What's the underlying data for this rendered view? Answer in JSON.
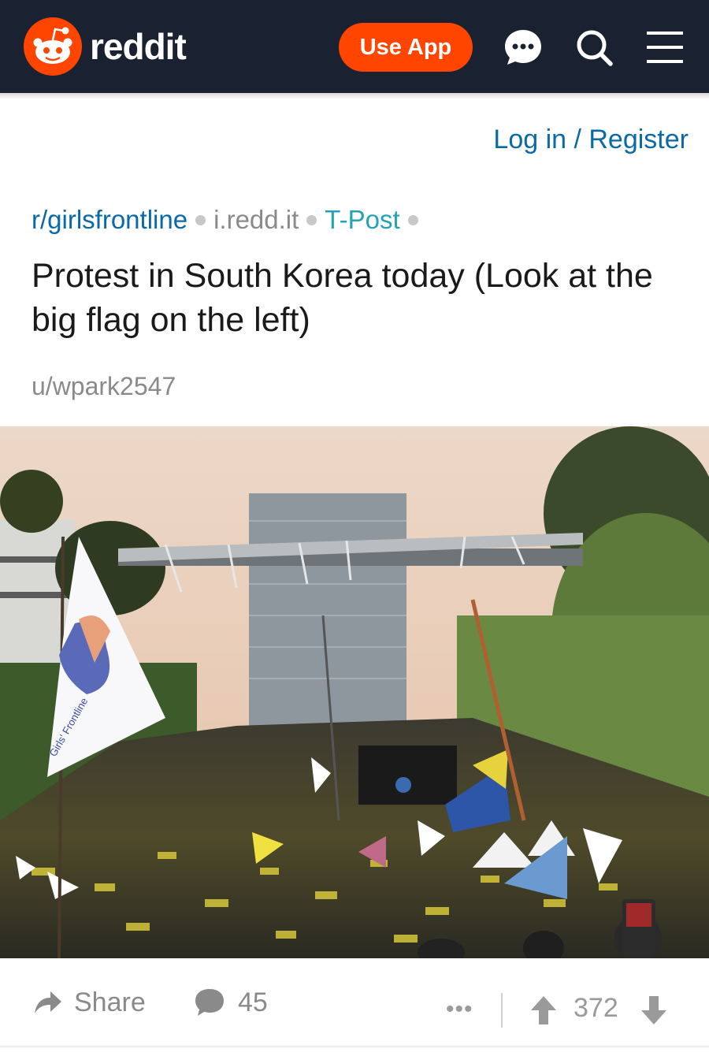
{
  "header": {
    "logo_text": "reddit",
    "use_app_label": "Use App",
    "icons": [
      "chat-icon",
      "search-icon",
      "menu-icon"
    ],
    "brand_color": "#ff4500",
    "bar_color": "#1a2231"
  },
  "auth": {
    "login_label": "Log in / Register"
  },
  "post": {
    "subreddit": "r/girlsfrontline",
    "domain": "i.redd.it",
    "flair": "T-Post",
    "title": "Protest in South Korea today (Look at the big flag on the left)",
    "author": "u/wpark2547",
    "image_alt": "Photo of a large street protest crowd",
    "flag_text": "Girls' Frontline"
  },
  "actions": {
    "share_label": "Share",
    "comments_count": "45",
    "more_label": "•••",
    "score": "372"
  },
  "colors": {
    "link": "#0a6aa8",
    "flair": "#23a3b3",
    "muted": "#8a8a8a"
  }
}
